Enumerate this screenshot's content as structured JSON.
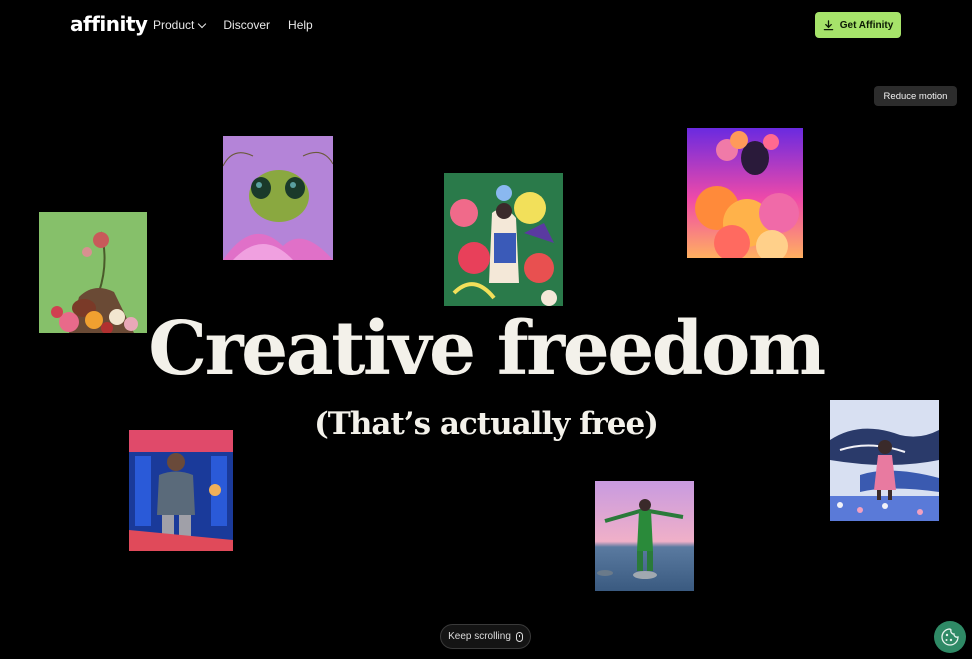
{
  "header": {
    "logo": "affinity",
    "nav": [
      {
        "label": "Product",
        "has_dropdown": true
      },
      {
        "label": "Discover"
      },
      {
        "label": "Help"
      }
    ],
    "cta_label": "Get Affinity",
    "cta_color": "#a6e36a"
  },
  "reduce_motion_label": "Reduce motion",
  "hero": {
    "headline": "Creative freedom",
    "subheadline": "(That’s actually free)"
  },
  "artworks": [
    {
      "id": "flower-sculpture"
    },
    {
      "id": "grasshopper"
    },
    {
      "id": "floral-illustration"
    },
    {
      "id": "woman-with-flowers"
    },
    {
      "id": "whale-illustration"
    },
    {
      "id": "man-on-subway"
    },
    {
      "id": "dancer-on-water"
    }
  ],
  "footer": {
    "keep_scrolling_label": "Keep scrolling",
    "cookie_icon": "cookie-icon",
    "cookie_color": "#2f8a66"
  }
}
